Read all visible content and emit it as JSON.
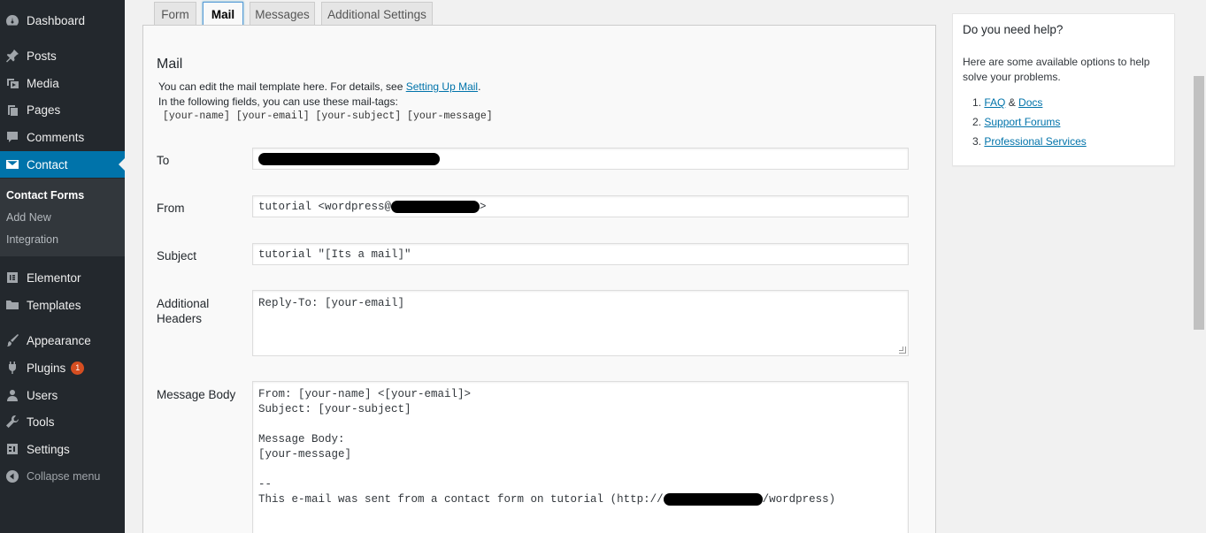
{
  "sidebar": {
    "items": [
      {
        "label": "Dashboard",
        "icon": "dashboard-icon"
      },
      {
        "label": "Posts",
        "icon": "pin-icon"
      },
      {
        "label": "Media",
        "icon": "media-icon"
      },
      {
        "label": "Pages",
        "icon": "pages-icon"
      },
      {
        "label": "Comments",
        "icon": "comment-icon"
      },
      {
        "label": "Contact",
        "icon": "mail-icon",
        "active": true
      },
      {
        "label": "Elementor",
        "icon": "elementor-icon"
      },
      {
        "label": "Templates",
        "icon": "folder-icon"
      },
      {
        "label": "Appearance",
        "icon": "brush-icon"
      },
      {
        "label": "Plugins",
        "icon": "plugin-icon",
        "badge": "1"
      },
      {
        "label": "Users",
        "icon": "user-icon"
      },
      {
        "label": "Tools",
        "icon": "wrench-icon"
      },
      {
        "label": "Settings",
        "icon": "settings-icon"
      }
    ],
    "submenu": [
      "Contact Forms",
      "Add New",
      "Integration"
    ],
    "collapse_label": "Collapse menu",
    "accent": "#0073aa"
  },
  "tabs": [
    "Form",
    "Mail",
    "Messages",
    "Additional Settings"
  ],
  "mail": {
    "heading": "Mail",
    "desc_prefix": "You can edit the mail template here. For details, see ",
    "desc_link": "Setting Up Mail",
    "desc_suffix": ".",
    "desc_line2": "In the following fields, you can use these mail-tags:",
    "mail_tags": "[your-name] [your-email] [your-subject] [your-message]",
    "fields": {
      "to_label": "To",
      "to_value": "",
      "from_label": "From",
      "from_value_prefix": "tutorial <wordpress@",
      "from_value_suffix": ">",
      "subject_label": "Subject",
      "subject_value": "tutorial \"[Its a mail]\"",
      "headers_label": "Additional Headers",
      "headers_value": "Reply-To: [your-email]",
      "body_label": "Message Body",
      "body_lines": [
        "From: [your-name] <[your-email]>",
        "Subject: [your-subject]",
        "",
        "Message Body:",
        "[your-message]",
        "",
        "--"
      ],
      "body_last_prefix": "This e-mail was sent from a contact form on tutorial (http://",
      "body_last_suffix": "/wordpress)"
    }
  },
  "help": {
    "title": "Do you need help?",
    "text": "Here are some available options to help solve your problems.",
    "items": [
      {
        "num": "1.",
        "link": "FAQ",
        "sep": " & ",
        "link2": "Docs"
      },
      {
        "num": "2.",
        "link": "Support Forums"
      },
      {
        "num": "3.",
        "link": "Professional Services"
      }
    ]
  }
}
